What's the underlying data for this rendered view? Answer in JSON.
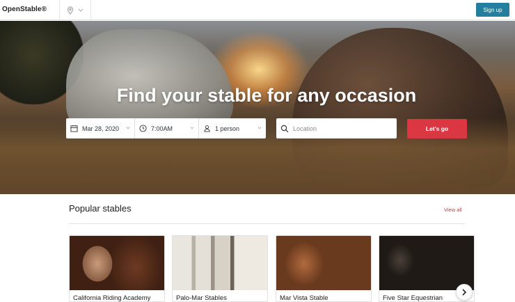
{
  "header": {
    "brand": "OpenStable®",
    "signup_label": "Sign up"
  },
  "hero": {
    "title": "Find your stable for any occasion",
    "search": {
      "date": "Mar 28, 2020",
      "time": "7:00AM",
      "party": "1 person",
      "location_placeholder": "Location",
      "submit_label": "Let's go"
    }
  },
  "popular": {
    "title": "Popular stables",
    "view_all_label": "View all",
    "cards": [
      {
        "name": "California Riding Academy"
      },
      {
        "name": "Palo-Mar Stables"
      },
      {
        "name": "Mar Vista Stable"
      },
      {
        "name": "Five Star Equestrian"
      }
    ]
  },
  "colors": {
    "accent": "#da3743",
    "signup": "#247f9e"
  }
}
